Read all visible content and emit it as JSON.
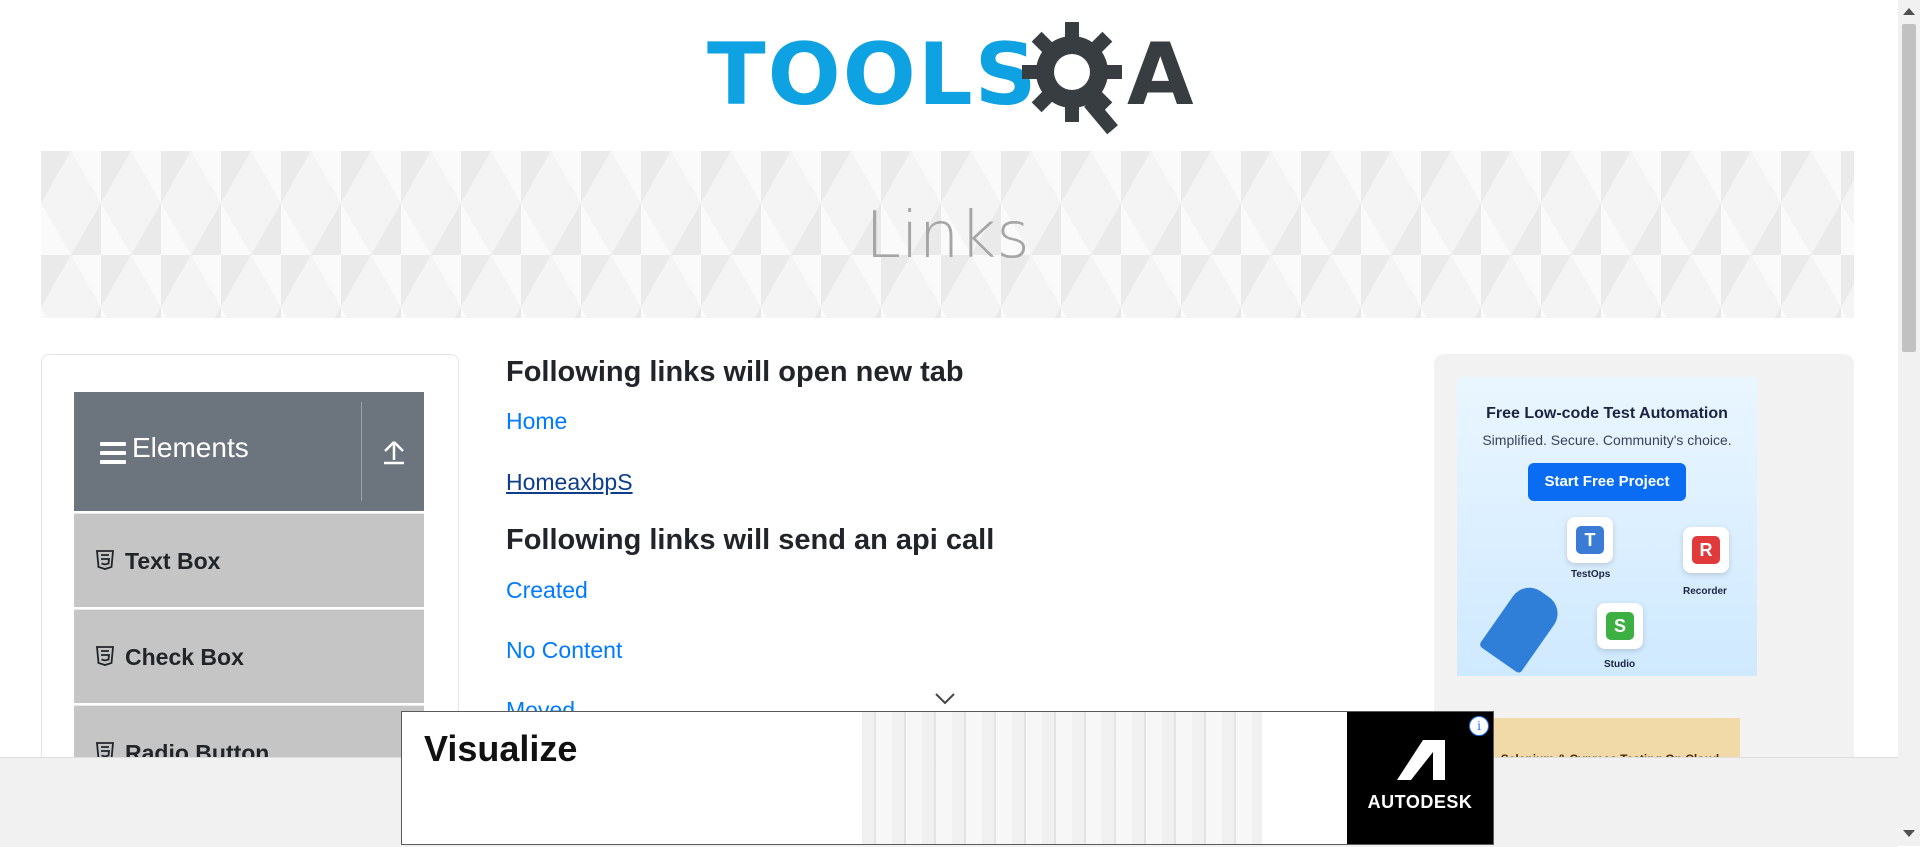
{
  "header": {
    "logo_text": "TOOLS",
    "logo_suffix": "A",
    "banner_title": "Links"
  },
  "sidebar": {
    "group_title": "Elements",
    "items": [
      {
        "label": "Text Box"
      },
      {
        "label": "Check Box"
      },
      {
        "label": "Radio Button"
      }
    ]
  },
  "main": {
    "new_tab_heading": "Following links will open new tab",
    "new_tab_links": [
      "Home",
      "HomeaxbpS"
    ],
    "api_heading": "Following links will send an api call",
    "api_links": [
      "Created",
      "No Content",
      "Moved"
    ]
  },
  "right_ad": {
    "headline": "Free Low-code Test Automation",
    "subline": "Simplified. Secure. Community's choice.",
    "button": "Start Free Project",
    "tiles": [
      {
        "letter": "T",
        "caption": "TestOps",
        "color": "#3a7bd5"
      },
      {
        "letter": "R",
        "caption": "Recorder",
        "color": "#e03a3a"
      },
      {
        "letter": "S",
        "caption": "Studio",
        "color": "#3cb043"
      }
    ],
    "strip_text": "Selenium & Cypress Testing On Cloud"
  },
  "bottom_ad": {
    "headline": "Visualize",
    "brand": "AUTODESK",
    "info": "i"
  },
  "colors": {
    "link": "#007bff",
    "link_visited": "#0c3e8c",
    "sidebar_header": "#6c757d",
    "sidebar_item": "#c5c5c5",
    "logo_blue": "#0ea2e3"
  }
}
